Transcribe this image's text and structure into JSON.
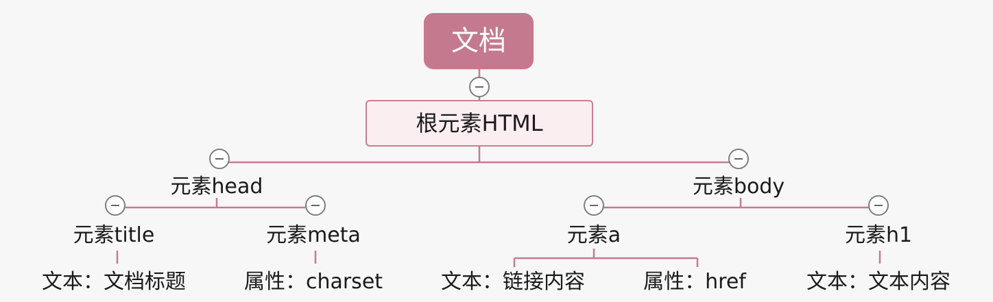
{
  "diagram": {
    "root": "文档",
    "html": "根元素HTML",
    "head": "元素head",
    "body": "元素body",
    "title": "元素title",
    "meta": "元素meta",
    "a": "元素a",
    "h1": "元素h1",
    "title_text": "文本：文档标题",
    "meta_attr": "属性：charset",
    "a_text": "文本：链接内容",
    "a_attr": "属性：href",
    "h1_text": "文本：文本内容"
  },
  "colors": {
    "root_fill": "#c4798f",
    "html_fill": "#fbeef1",
    "html_border": "#c67f93",
    "connector": "#c57a92",
    "toggle_border": "#7d7d7d",
    "background": "#f7f7f7"
  }
}
